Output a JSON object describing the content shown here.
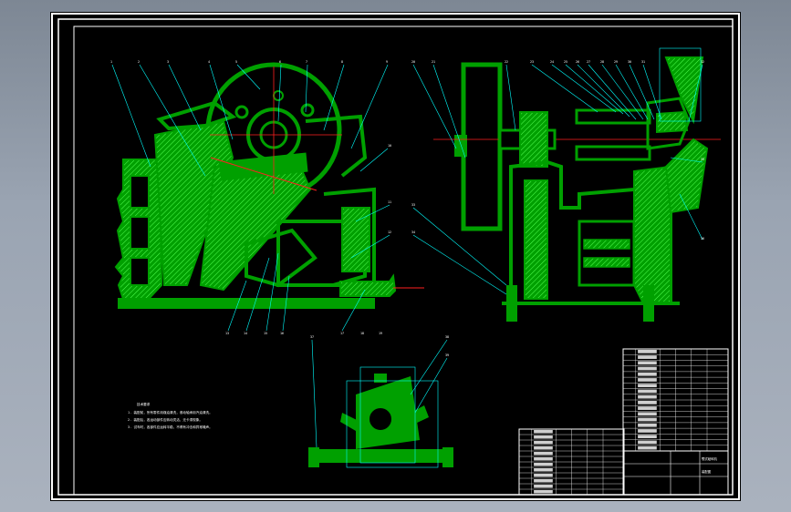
{
  "sheet": {
    "name": "jaw-crusher-assembly-drawing",
    "colors": {
      "background": "#000000",
      "part_fill": "#00a000",
      "hatch": "#33ff33",
      "leader": "#00ffff",
      "text": "#ffffff",
      "frame": "#ffffff",
      "centerline": "#ff2020"
    }
  },
  "main_view_labels": [
    "1",
    "2",
    "3",
    "4",
    "5",
    "6",
    "7",
    "8",
    "9",
    "10",
    "11",
    "12",
    "13",
    "14",
    "15",
    "16",
    "17",
    "18",
    "19"
  ],
  "side_view_labels": [
    "20",
    "21",
    "22",
    "23",
    "24",
    "25",
    "26",
    "27",
    "28",
    "29",
    "30",
    "31",
    "32",
    "33",
    "34",
    "35",
    "36",
    "37",
    "38",
    "39"
  ],
  "notes": {
    "heading": "技术要求",
    "lines": [
      "1. 装配前，所有零件用煤油清洗，滚动轴承用汽油清洗。",
      "2. 装配后，各运动部件应转动灵活，无卡滞现象。",
      "3. 试车时，各部件应运转平稳，不得有冲击和异常噪声。"
    ]
  },
  "title_block": {
    "title": "颚式破碎机",
    "drawing_no": "装配图"
  }
}
